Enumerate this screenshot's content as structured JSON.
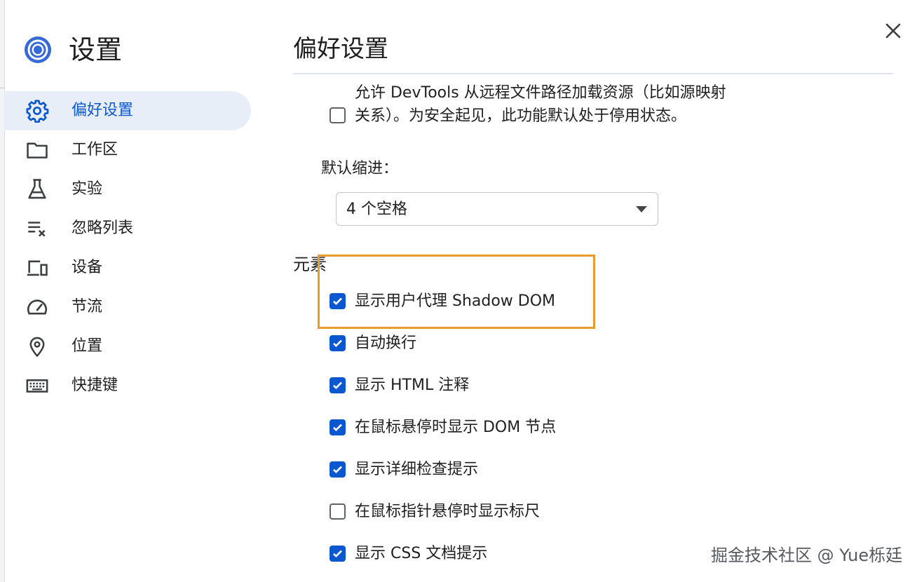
{
  "app": {
    "title": "设置"
  },
  "nav": [
    {
      "label": "偏好设置",
      "icon": "gear-icon",
      "active": true
    },
    {
      "label": "工作区",
      "icon": "folder-icon"
    },
    {
      "label": "实验",
      "icon": "flask-icon"
    },
    {
      "label": "忽略列表",
      "icon": "ignore-list-icon"
    },
    {
      "label": "设备",
      "icon": "devices-icon"
    },
    {
      "label": "节流",
      "icon": "speedometer-icon"
    },
    {
      "label": "位置",
      "icon": "location-pin-icon"
    },
    {
      "label": "快捷键",
      "icon": "keyboard-icon"
    }
  ],
  "panel": {
    "title": "偏好设置",
    "remote_paths": {
      "checked": false,
      "text": "允许 DevTools 从远程文件路径加载资源（比如源映射关系）。为安全起见，此功能默认处于停用状态。"
    },
    "indent": {
      "label": "默认缩进：",
      "value": "4 个空格"
    },
    "elements_section": "元素",
    "options": [
      {
        "label": "显示用户代理 Shadow DOM",
        "checked": true
      },
      {
        "label": "自动换行",
        "checked": true
      },
      {
        "label": "显示 HTML 注释",
        "checked": true
      },
      {
        "label": "在鼠标悬停时显示 DOM 节点",
        "checked": true
      },
      {
        "label": "显示详细检查提示",
        "checked": true
      },
      {
        "label": "在鼠标指针悬停时显示标尺",
        "checked": false
      },
      {
        "label": "显示 CSS 文档提示",
        "checked": true
      }
    ]
  },
  "watermark": "掘金技术社区 @ Yue栎廷",
  "colors": {
    "accent": "#0b57d0",
    "highlight": "#e89a2c",
    "active_bg": "#e8eef7"
  }
}
